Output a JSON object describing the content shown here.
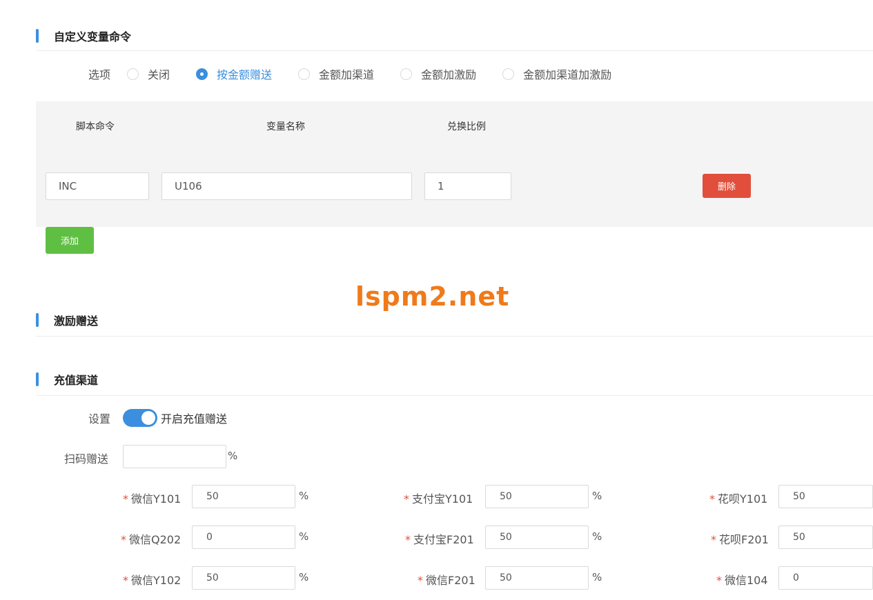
{
  "sections": {
    "custom_var": "自定义变量命令",
    "incentive": "激励赠送",
    "channel": "充值渠道"
  },
  "options": {
    "label": "选项",
    "items": [
      {
        "label": "关闭",
        "checked": false
      },
      {
        "label": "按金额赠送",
        "checked": true
      },
      {
        "label": "金额加渠道",
        "checked": false
      },
      {
        "label": "金额加激励",
        "checked": false
      },
      {
        "label": "金额加渠道加激励",
        "checked": false
      }
    ]
  },
  "table": {
    "headers": [
      "脚本命令",
      "变量名称",
      "兑换比例"
    ],
    "row": {
      "command": "INC",
      "variable": "U106",
      "ratio": "1"
    },
    "delete_label": "删除"
  },
  "add_label": "添加",
  "watermark": "lspm2.net",
  "channel": {
    "setting_label": "设置",
    "toggle_text": "开启充值赠送",
    "toggle_on": true,
    "scan_label": "扫码赠送",
    "scan_value": "",
    "pct": "%",
    "rows": [
      [
        {
          "label": "微信Y101",
          "value": "50"
        },
        {
          "label": "支付宝Y101",
          "value": "50"
        },
        {
          "label": "花呗Y101",
          "value": "50"
        }
      ],
      [
        {
          "label": "微信Q202",
          "value": "0"
        },
        {
          "label": "支付宝F201",
          "value": "50"
        },
        {
          "label": "花呗F201",
          "value": "50"
        }
      ],
      [
        {
          "label": "微信Y102",
          "value": "50"
        },
        {
          "label": "微信F201",
          "value": "50"
        },
        {
          "label": "微信104",
          "value": "0"
        }
      ]
    ]
  },
  "colors": {
    "accent": "#3b8fde",
    "danger": "#e14f3c",
    "success": "#5fbf43",
    "watermark": "#f07a1a"
  }
}
